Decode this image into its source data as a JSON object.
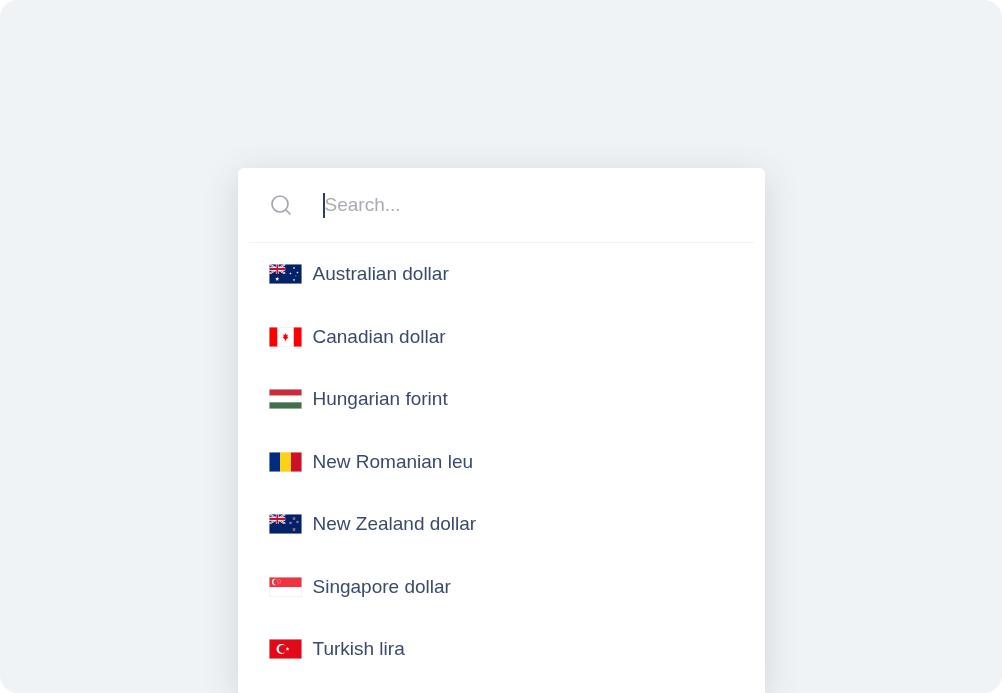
{
  "search": {
    "placeholder": "Search...",
    "focused": true
  },
  "currencies": [
    {
      "label": "Australian dollar",
      "kind": "australia"
    },
    {
      "label": "Canadian dollar",
      "kind": "canada"
    },
    {
      "label": "Hungarian forint",
      "kind": "hungary"
    },
    {
      "label": "New Romanian leu",
      "kind": "romania"
    },
    {
      "label": "New Zealand dollar",
      "kind": "newzealand"
    },
    {
      "label": "Singapore dollar",
      "kind": "singapore"
    },
    {
      "label": "Turkish lira",
      "kind": "turkey"
    }
  ]
}
